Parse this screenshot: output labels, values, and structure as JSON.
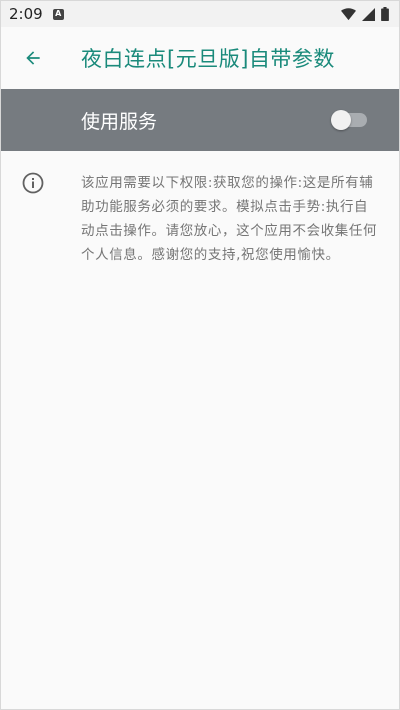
{
  "status_bar": {
    "time": "2:09",
    "notification_icon": "A",
    "icons": [
      "wifi-icon",
      "cell-signal-icon",
      "battery-icon"
    ]
  },
  "app_bar": {
    "back_icon": "arrow-back-icon",
    "title": "夜白连点[元旦版]自带参数"
  },
  "master_switch": {
    "label": "使用服务",
    "checked": false
  },
  "description": {
    "icon": "info-icon",
    "text": "该应用需要以下权限:获取您的操作:这是所有辅助功能服务必须的要求。模拟点击手势:执行自动点击操作。请您放心，这个应用不会收集任何个人信息。感谢您的支持,祝您使用愉快。"
  },
  "colors": {
    "accent": "#1a8a7b",
    "switch_bar": "#767b80",
    "background": "#fafafa",
    "description_text": "#757575"
  }
}
